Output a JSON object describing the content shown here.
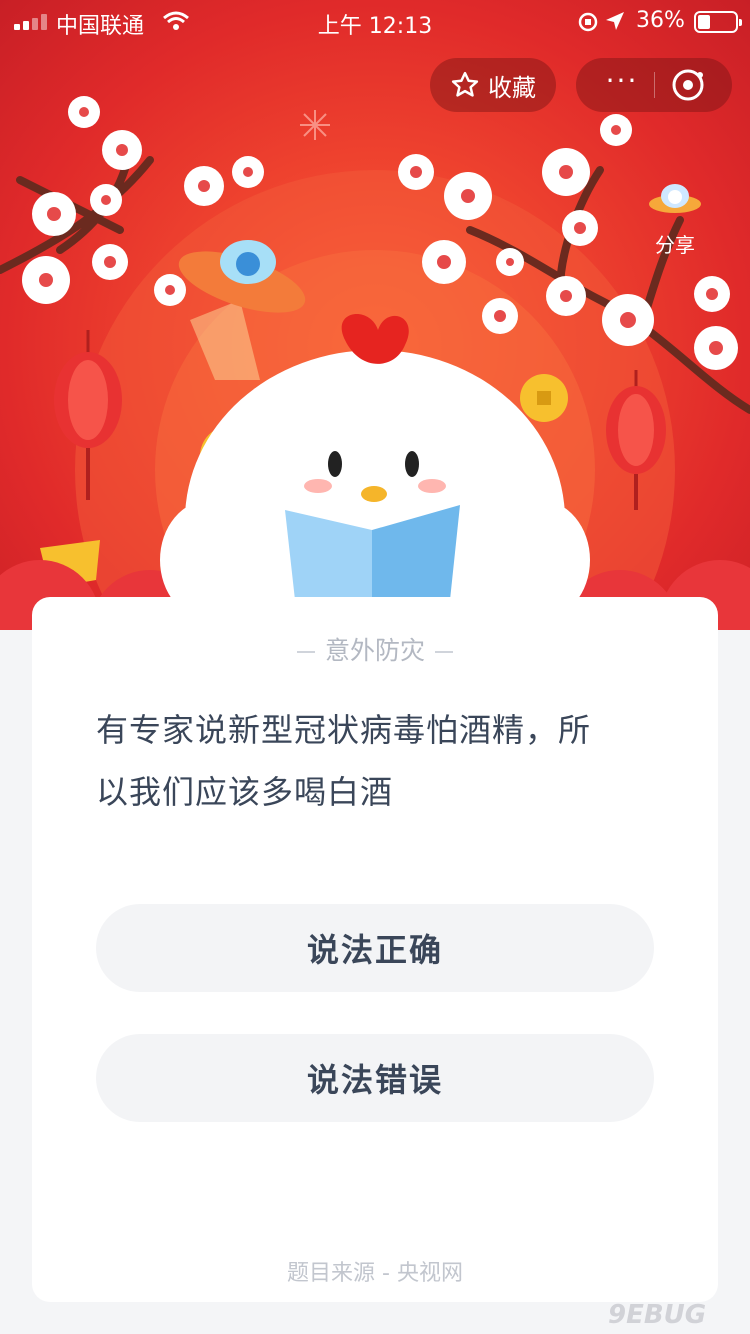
{
  "status_bar": {
    "carrier": "中国联通",
    "time": "上午 12:13",
    "battery": "36%"
  },
  "header": {
    "favorite_label": "收藏",
    "more_label": "···",
    "share_label": "分享"
  },
  "quiz": {
    "category": "意外防灾",
    "question_line1": "有专家说新型冠状病毒怕酒精，所",
    "question_line2": "以我们应该多喝白酒",
    "options": [
      {
        "label": "说法正确"
      },
      {
        "label": "说法错误"
      }
    ],
    "source": "题目来源 - 央视网"
  },
  "watermark": "9EBUG",
  "colors": {
    "hero_red": "#e02a2a",
    "text_dark": "#3a4659",
    "text_muted": "#b3b8c2",
    "option_bg": "#f3f4f6"
  },
  "icons": [
    "star-icon",
    "more-icon",
    "close-icon",
    "ufo-share-icon",
    "signal-icon",
    "wifi-icon",
    "location-icon",
    "battery-icon"
  ]
}
